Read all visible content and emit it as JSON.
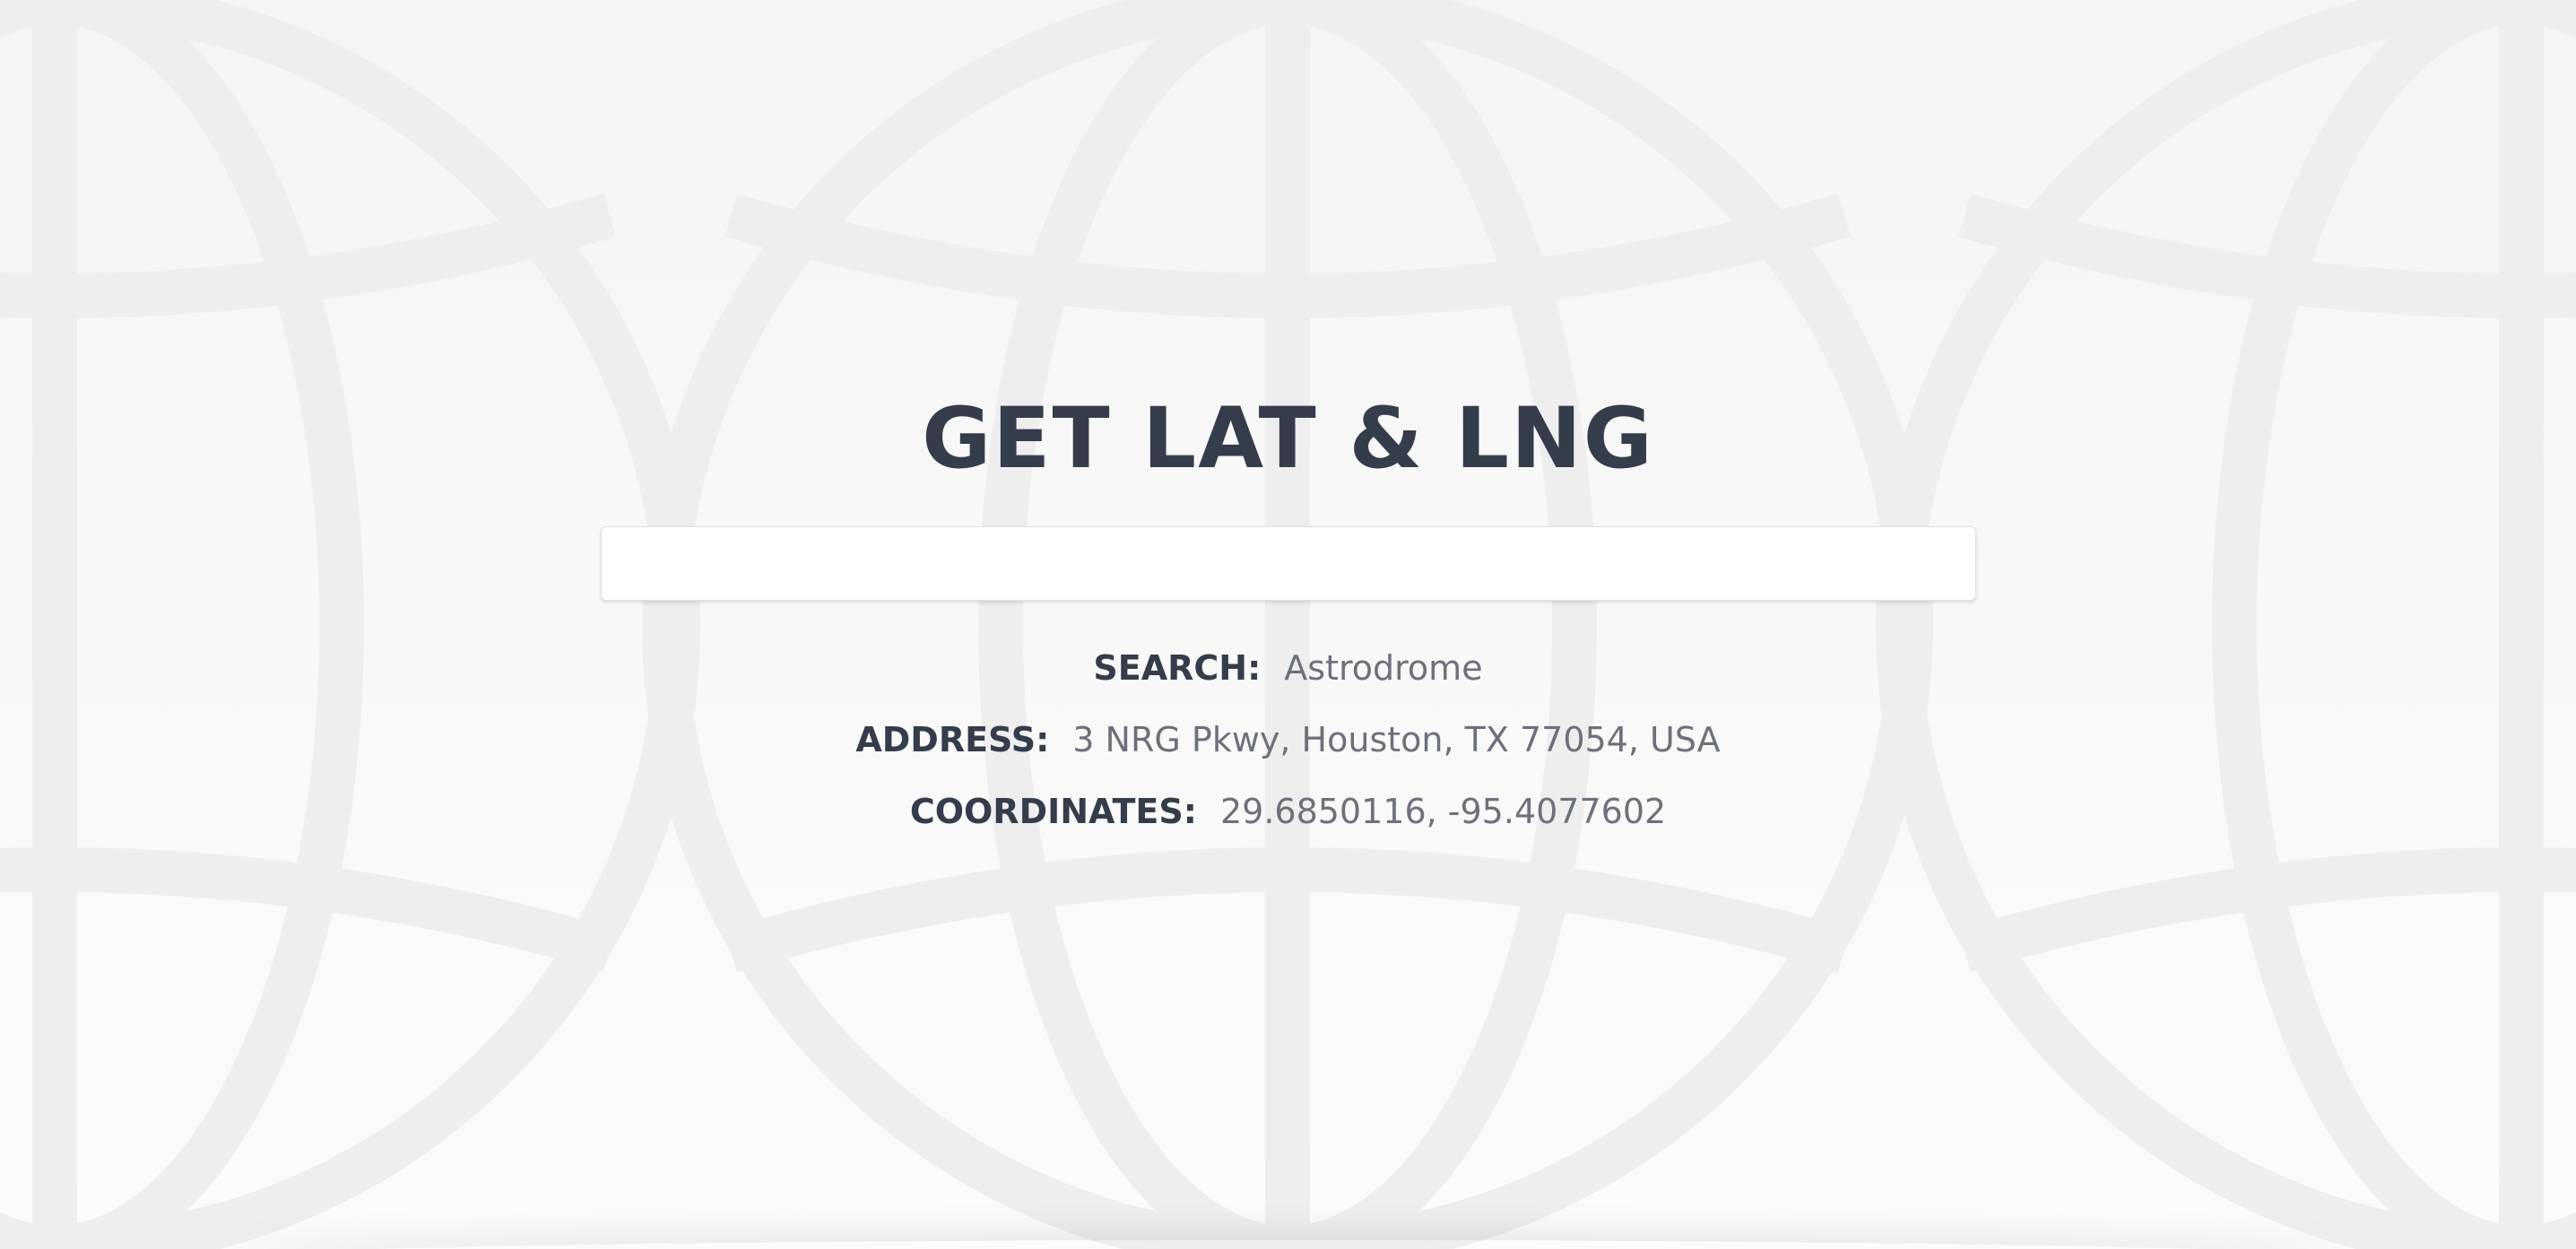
{
  "header": {
    "title": "GET LAT & LNG"
  },
  "search": {
    "value": "",
    "placeholder": ""
  },
  "results": {
    "search_label": "SEARCH:",
    "search_value": "Astrodrome",
    "address_label": "ADDRESS:",
    "address_value": "3 NRG Pkwy, Houston, TX 77054, USA",
    "coordinates_label": "COORDINATES:",
    "coordinates_value": "29.6850116, -95.4077602"
  },
  "background": {
    "icon": "globe-icon",
    "color": "#f7f7f7",
    "pattern_color": "#ececec"
  },
  "colors": {
    "heading": "#353d4b",
    "value_text": "#6c717b",
    "input_background": "#ffffff"
  }
}
